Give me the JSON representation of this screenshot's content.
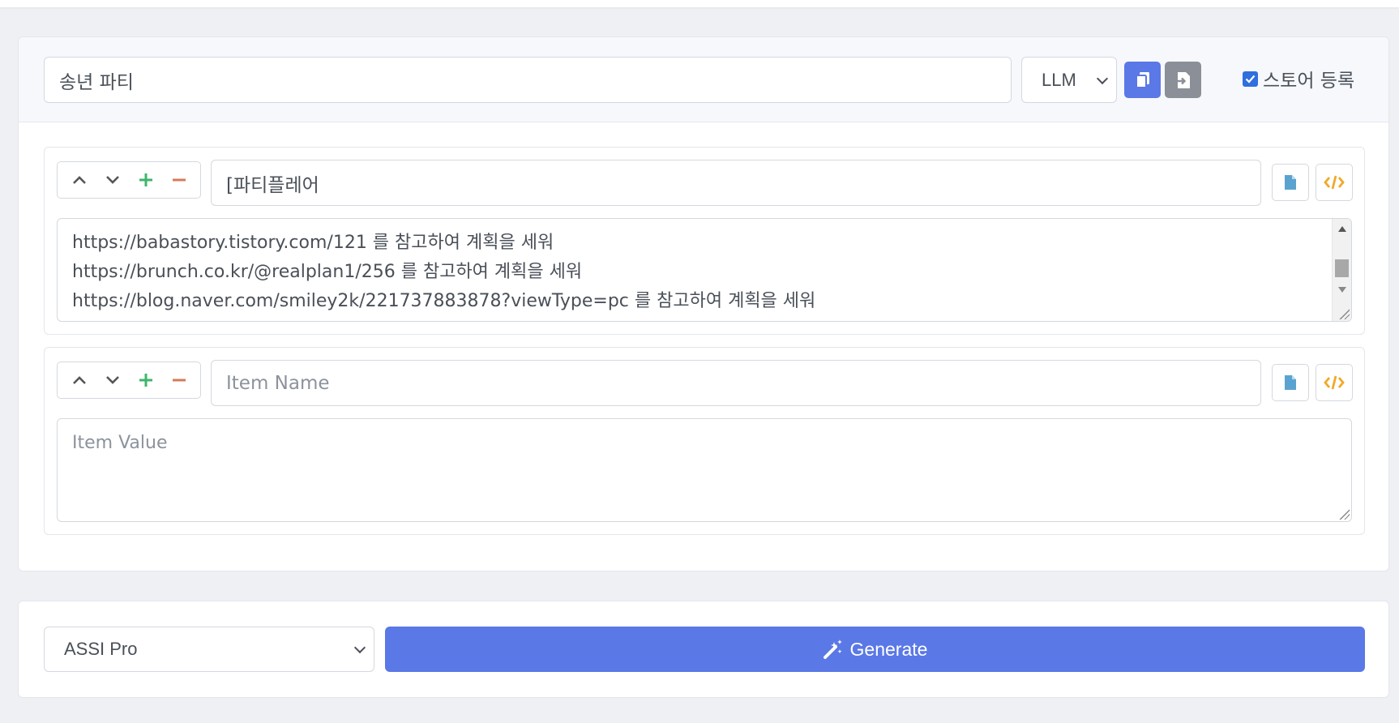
{
  "header": {
    "title_value": "송년 파티",
    "model_select": "LLM",
    "store_label": "스토어 등록",
    "store_checked": true
  },
  "items": [
    {
      "name_value": "[파티플레어",
      "name_placeholder": "Item Name",
      "value_lines": [
        "https://babastory.tistory.com/121 를 참고하여 계획을 세워",
        "https://brunch.co.kr/@realplan1/256 를 참고하여 계획을 세워",
        "https://blog.naver.com/smiley2k/221737883878?viewType=pc 를 참고하여 계획을 세워"
      ]
    },
    {
      "name_value": "",
      "name_placeholder": "Item Name",
      "value_placeholder": "Item Value"
    }
  ],
  "footer": {
    "assistant_select": "ASSI Pro",
    "generate_label": "Generate"
  },
  "icons": {
    "up": "chevron-up-icon",
    "down": "chevron-down-icon",
    "add": "plus-icon",
    "remove": "minus-icon",
    "doc": "file-icon",
    "code": "code-icon",
    "copy": "copy-icon",
    "import": "import-icon",
    "magic": "magic-wand-icon"
  },
  "colors": {
    "primary": "#5a78e6",
    "secondary": "#8a8f98",
    "plus": "#3fb56b",
    "minus": "#d47a5c",
    "doc": "#5aa3d0",
    "code": "#f0a92a"
  }
}
